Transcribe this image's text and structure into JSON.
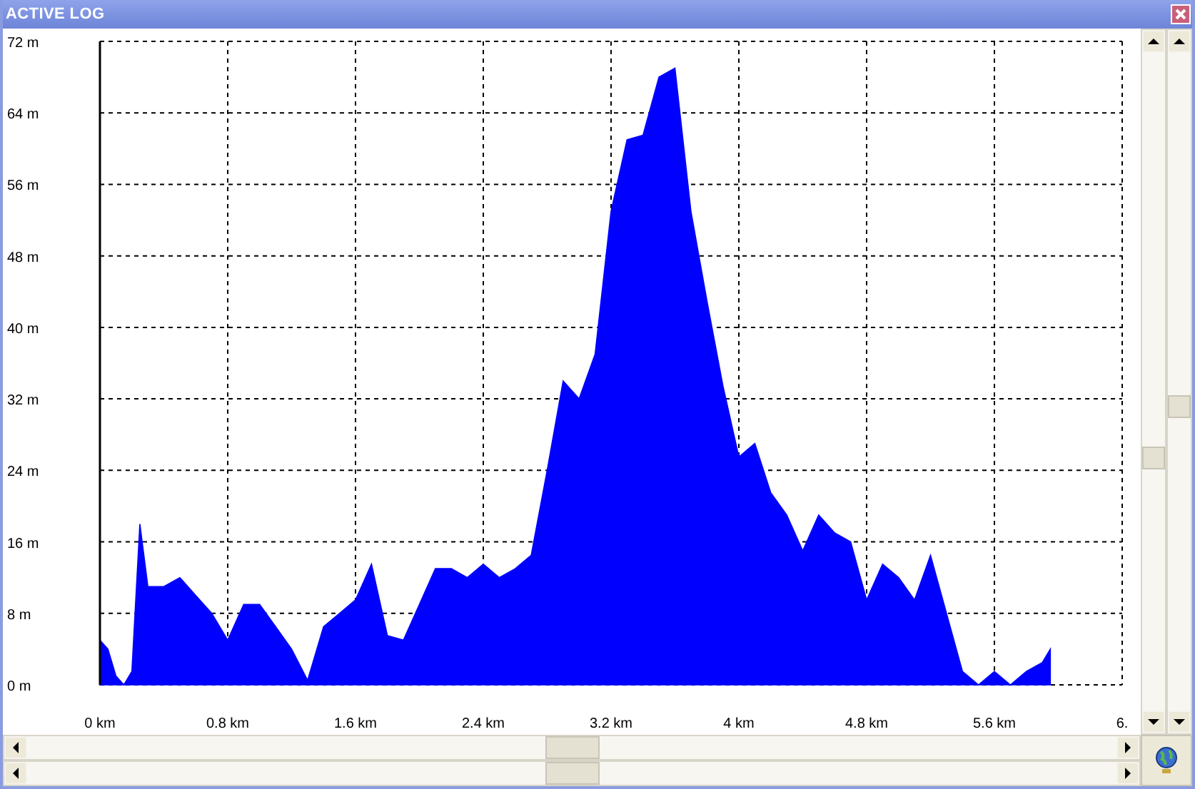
{
  "window": {
    "title": "ACTIVE LOG"
  },
  "chart_data": {
    "type": "area",
    "grid": true,
    "x": [
      0,
      0.05,
      0.1,
      0.15,
      0.2,
      0.25,
      0.3,
      0.4,
      0.5,
      0.6,
      0.7,
      0.8,
      0.9,
      1.0,
      1.1,
      1.2,
      1.3,
      1.4,
      1.5,
      1.6,
      1.7,
      1.8,
      1.9,
      2.0,
      2.1,
      2.2,
      2.3,
      2.4,
      2.5,
      2.6,
      2.7,
      2.8,
      2.9,
      3.0,
      3.1,
      3.2,
      3.3,
      3.4,
      3.5,
      3.6,
      3.7,
      3.8,
      3.9,
      4.0,
      4.1,
      4.2,
      4.3,
      4.4,
      4.5,
      4.6,
      4.7,
      4.8,
      4.9,
      5.0,
      5.1,
      5.2,
      5.3,
      5.4,
      5.5,
      5.6,
      5.7,
      5.8,
      5.9,
      5.95
    ],
    "series": [
      {
        "color": "#0000ff",
        "values": [
          5,
          4,
          1,
          0,
          1.5,
          18,
          11,
          11,
          12,
          10,
          8,
          5,
          9,
          9,
          6.5,
          4,
          0.5,
          6.5,
          8,
          9.5,
          13.5,
          5.5,
          5,
          9,
          13,
          13,
          12,
          13.5,
          12,
          13,
          14.5,
          24,
          34,
          32,
          37,
          53,
          61,
          61.5,
          68,
          69,
          53,
          43,
          33.5,
          25.5,
          27,
          21.5,
          19,
          15,
          19,
          17,
          16,
          9.5,
          13.5,
          12,
          9.5,
          14.5,
          8,
          1.5,
          0,
          1.5,
          0,
          1.5,
          2.5,
          4
        ]
      }
    ],
    "xlim": [
      0,
      6.4
    ],
    "ylim": [
      0,
      72
    ],
    "xticks": [
      {
        "value": 0,
        "label": "0 km"
      },
      {
        "value": 0.8,
        "label": "0.8 km"
      },
      {
        "value": 1.6,
        "label": "1.6 km"
      },
      {
        "value": 2.4,
        "label": "2.4 km"
      },
      {
        "value": 3.2,
        "label": "3.2 km"
      },
      {
        "value": 4,
        "label": "4 km"
      },
      {
        "value": 4.8,
        "label": "4.8 km"
      },
      {
        "value": 5.6,
        "label": "5.6 km"
      },
      {
        "value": 6.4,
        "label": "6."
      }
    ],
    "yticks": [
      {
        "value": 0,
        "label": "0 m"
      },
      {
        "value": 8,
        "label": "8 m"
      },
      {
        "value": 16,
        "label": "16 m"
      },
      {
        "value": 24,
        "label": "24 m"
      },
      {
        "value": 32,
        "label": "32 m"
      },
      {
        "value": 40,
        "label": "40 m"
      },
      {
        "value": 48,
        "label": "48 m"
      },
      {
        "value": 56,
        "label": "56 m"
      },
      {
        "value": 64,
        "label": "64 m"
      },
      {
        "value": 72,
        "label": "72 m"
      }
    ]
  }
}
